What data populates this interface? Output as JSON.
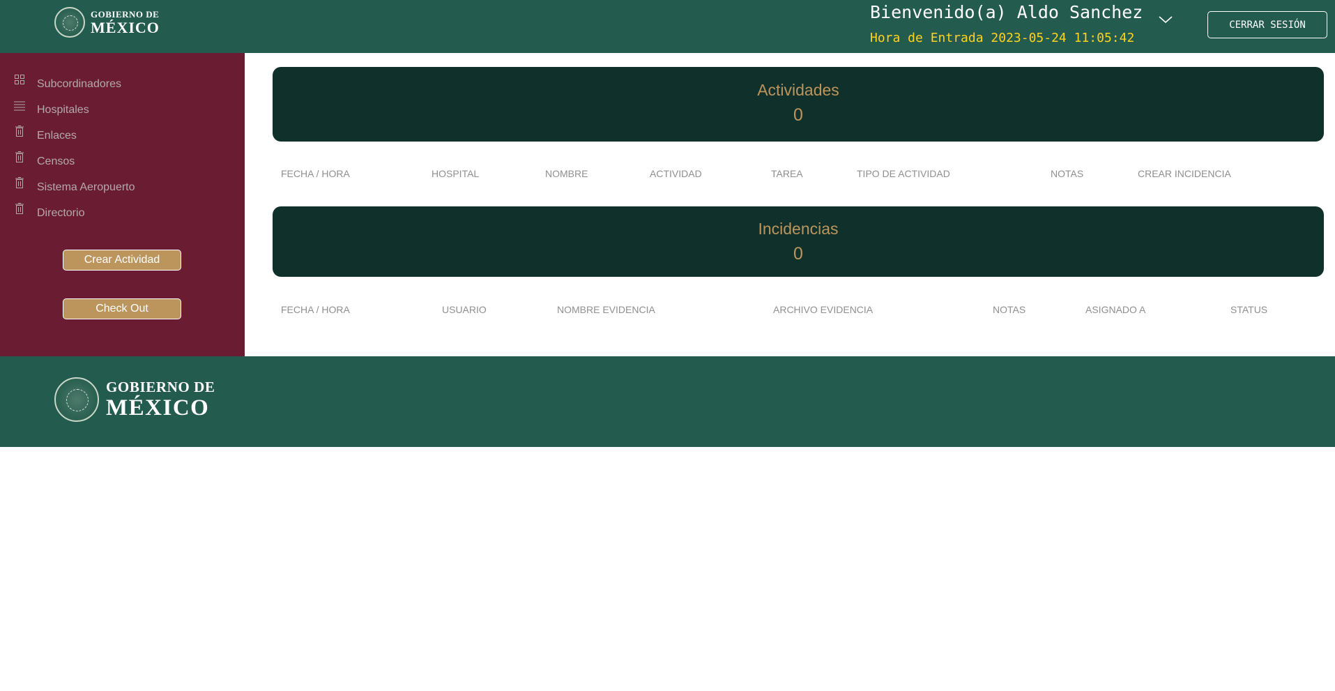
{
  "header": {
    "logo_line1": "GOBIERNO DE",
    "logo_line2": "MÉXICO",
    "welcome": "Bienvenido(a) Aldo Sanchez",
    "entry_time": "Hora de Entrada 2023-05-24 11:05:42",
    "logout_label": "CERRAR SESIÓN"
  },
  "sidebar": {
    "items": [
      {
        "label": "Subcordinadores",
        "icon": "grid-icon"
      },
      {
        "label": "Hospitales",
        "icon": "list-icon"
      },
      {
        "label": "Enlaces",
        "icon": "trash-icon"
      },
      {
        "label": "Censos",
        "icon": "trash-icon"
      },
      {
        "label": "Sistema Aeropuerto",
        "icon": "trash-icon"
      },
      {
        "label": "Directorio",
        "icon": "trash-icon"
      }
    ],
    "create_activity_label": "Crear Actividad",
    "checkout_label": "Check Out"
  },
  "activities": {
    "title": "Actividades",
    "count": "0",
    "columns": [
      "FECHA / HORA",
      "HOSPITAL",
      "NOMBRE",
      "ACTIVIDAD",
      "TAREA",
      "TIPO DE ACTIVIDAD",
      "NOTAS",
      "CREAR INCIDENCIA"
    ]
  },
  "incidents": {
    "title": "Incidencias",
    "count": "0",
    "columns": [
      "FECHA / HORA",
      "USUARIO",
      "NOMBRE EVIDENCIA",
      "ARCHIVO EVIDENCIA",
      "NOTAS",
      "ASIGNADO A",
      "STATUS"
    ]
  },
  "footer": {
    "logo_line1": "GOBIERNO DE",
    "logo_line2": "MÉXICO"
  },
  "colors": {
    "header_green": "#235b4e",
    "sidebar_maroon": "#691c32",
    "banner_dark": "#10302b",
    "gold": "#bc955c",
    "entry_yellow": "#ffd21e"
  }
}
